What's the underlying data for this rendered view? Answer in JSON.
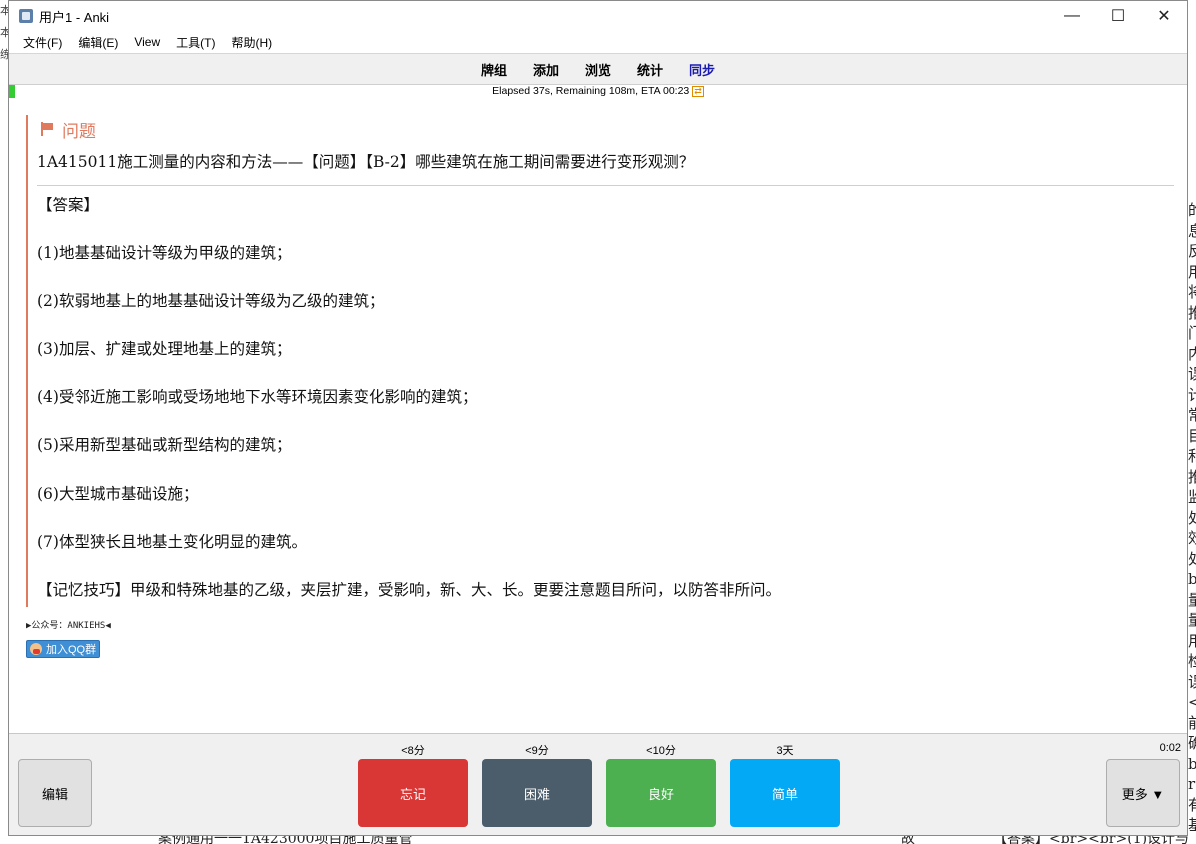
{
  "window": {
    "title": "用户1 - Anki",
    "minimize_glyph": "—",
    "maximize_glyph": "☐",
    "close_glyph": "✕"
  },
  "menu": [
    "文件(F)",
    "编辑(E)",
    "View",
    "工具(T)",
    "帮助(H)"
  ],
  "toolbar": {
    "decks": "牌组",
    "add": "添加",
    "browse": "浏览",
    "stats": "统计",
    "sync": "同步"
  },
  "progress": {
    "text": "Elapsed 37s, Remaining 108m, ETA 00:23",
    "badge": "⇄",
    "fraction": 0.005
  },
  "card": {
    "question_label": "问题",
    "question_text": "1A415011施工测量的内容和方法——【问题】【B-2】哪些建筑在施工期间需要进行变形观测？",
    "answer_lines": [
      "【答案】",
      "(1)地基基础设计等级为甲级的建筑；",
      "(2)软弱地基上的地基基础设计等级为乙级的建筑；",
      "(3)加层、扩建或处理地基上的建筑；",
      "(4)受邻近施工影响或受场地地下水等环境因素变化影响的建筑；",
      "(5)采用新型基础或新型结构的建筑；",
      "(6)大型城市基础设施；",
      "(7)体型狭长且地基土变化明显的建筑。",
      "【记忆技巧】甲级和特殊地基的乙级，夹层扩建，受影响，新、大、长。更要注意题目所问，以防答非所问。"
    ],
    "footer_text": "▶公众号：ANKIEHS◀",
    "qq_button_label": "加入QQ群"
  },
  "bottom": {
    "edit_label": "编辑",
    "more_label": "更多 ▼",
    "timer": "0:02",
    "buttons": [
      {
        "label": "忘记",
        "interval": "<8分",
        "color": "#d93636"
      },
      {
        "label": "困难",
        "interval": "<9分",
        "color": "#4b5d6b"
      },
      {
        "label": "良好",
        "interval": "<10分",
        "color": "#4caf50"
      },
      {
        "label": "简单",
        "interval": "3天",
        "color": "#03a9f4"
      }
    ]
  },
  "background": {
    "right_strip": [
      "的",
      "息",
      "反",
      "用",
      "将",
      "推",
      "门",
      "内",
      "误",
      "计",
      "常",
      "目",
      "和",
      "推",
      "监",
      "处",
      "效",
      "处",
      "b",
      "量",
      "量",
      "用",
      "检",
      "误",
      "<",
      "前",
      "确",
      "b",
      "r",
      "有",
      "基",
      "<",
      "具"
    ],
    "left_strip": [
      "本",
      "本",
      "练"
    ],
    "bottom_texts": [
      "案例通用一一1A423000项目施工质量管",
      "故",
      "【答案】<br><br>(1)设计与"
    ]
  }
}
